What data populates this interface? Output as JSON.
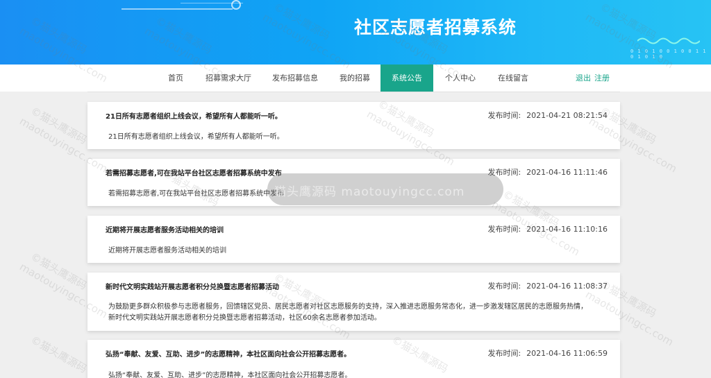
{
  "header": {
    "title": "社区志愿者招募系统"
  },
  "nav": {
    "items": [
      {
        "label": "首页"
      },
      {
        "label": "招募需求大厅"
      },
      {
        "label": "发布招募信息"
      },
      {
        "label": "我的招募"
      },
      {
        "label": "系统公告",
        "active": true
      },
      {
        "label": "个人中心"
      },
      {
        "label": "在线留言"
      }
    ],
    "logout_label": "退出",
    "register_label": "注册"
  },
  "notices": [
    {
      "title": "21日所有志愿者组织上线会议，希望所有人都能听一听。",
      "time_label": "发布时间:",
      "time": "2021-04-21 08:21:54",
      "body": "21日所有志愿者组织上线会议，希望所有人都能听一听。"
    },
    {
      "title": "若需招募志愿者,可在我站平台社区志愿者招募系统中发布",
      "time_label": "发布时间:",
      "time": "2021-04-16 11:11:46",
      "body": "若需招募志愿者,可在我站平台社区志愿者招募系统中发布"
    },
    {
      "title": "近期将开展志愿者服务活动相关的培训",
      "time_label": "发布时间:",
      "time": "2021-04-16 11:10:16",
      "body": "近期将开展志愿者服务活动相关的培训"
    },
    {
      "title": "新时代文明实践站开展志愿者积分兑换暨志愿者招募活动",
      "time_label": "发布时间:",
      "time": "2021-04-16 11:08:37",
      "body": "为鼓励更多群众积极参与志愿者服务，回馈辖区党员、居民志愿者对社区志愿服务的支持，深入推进志愿服务常态化，进一步激发辖区居民的志愿服务热情，新时代文明实践站开展志愿者积分兑换暨志愿者招募活动，社区60余名志愿者参加活动。"
    },
    {
      "title": "弘扬“奉献、友爱、互助、进步”的志愿精神，本社区面向社会公开招募志愿者。",
      "time_label": "发布时间:",
      "time": "2021-04-16 11:06:59",
      "body": "弘扬“奉献、友爱、互助、进步”的志愿精神，本社区面向社会公开招募志愿者。"
    }
  ],
  "watermark": {
    "text": "©猫头鹰源码",
    "url_text": "maotouyingcc.com",
    "overlay_text": "猫头鹰源码 maotouyingcc.com"
  },
  "banner_deco": {
    "dots": "0 1 0 1 0 0 1 0 0 1 1 0 1 0 1 0"
  },
  "colors": {
    "banner_start": "#1a8ff3",
    "banner_end": "#27c3f4",
    "accent": "#19a58b",
    "page_bg": "#efefef"
  }
}
